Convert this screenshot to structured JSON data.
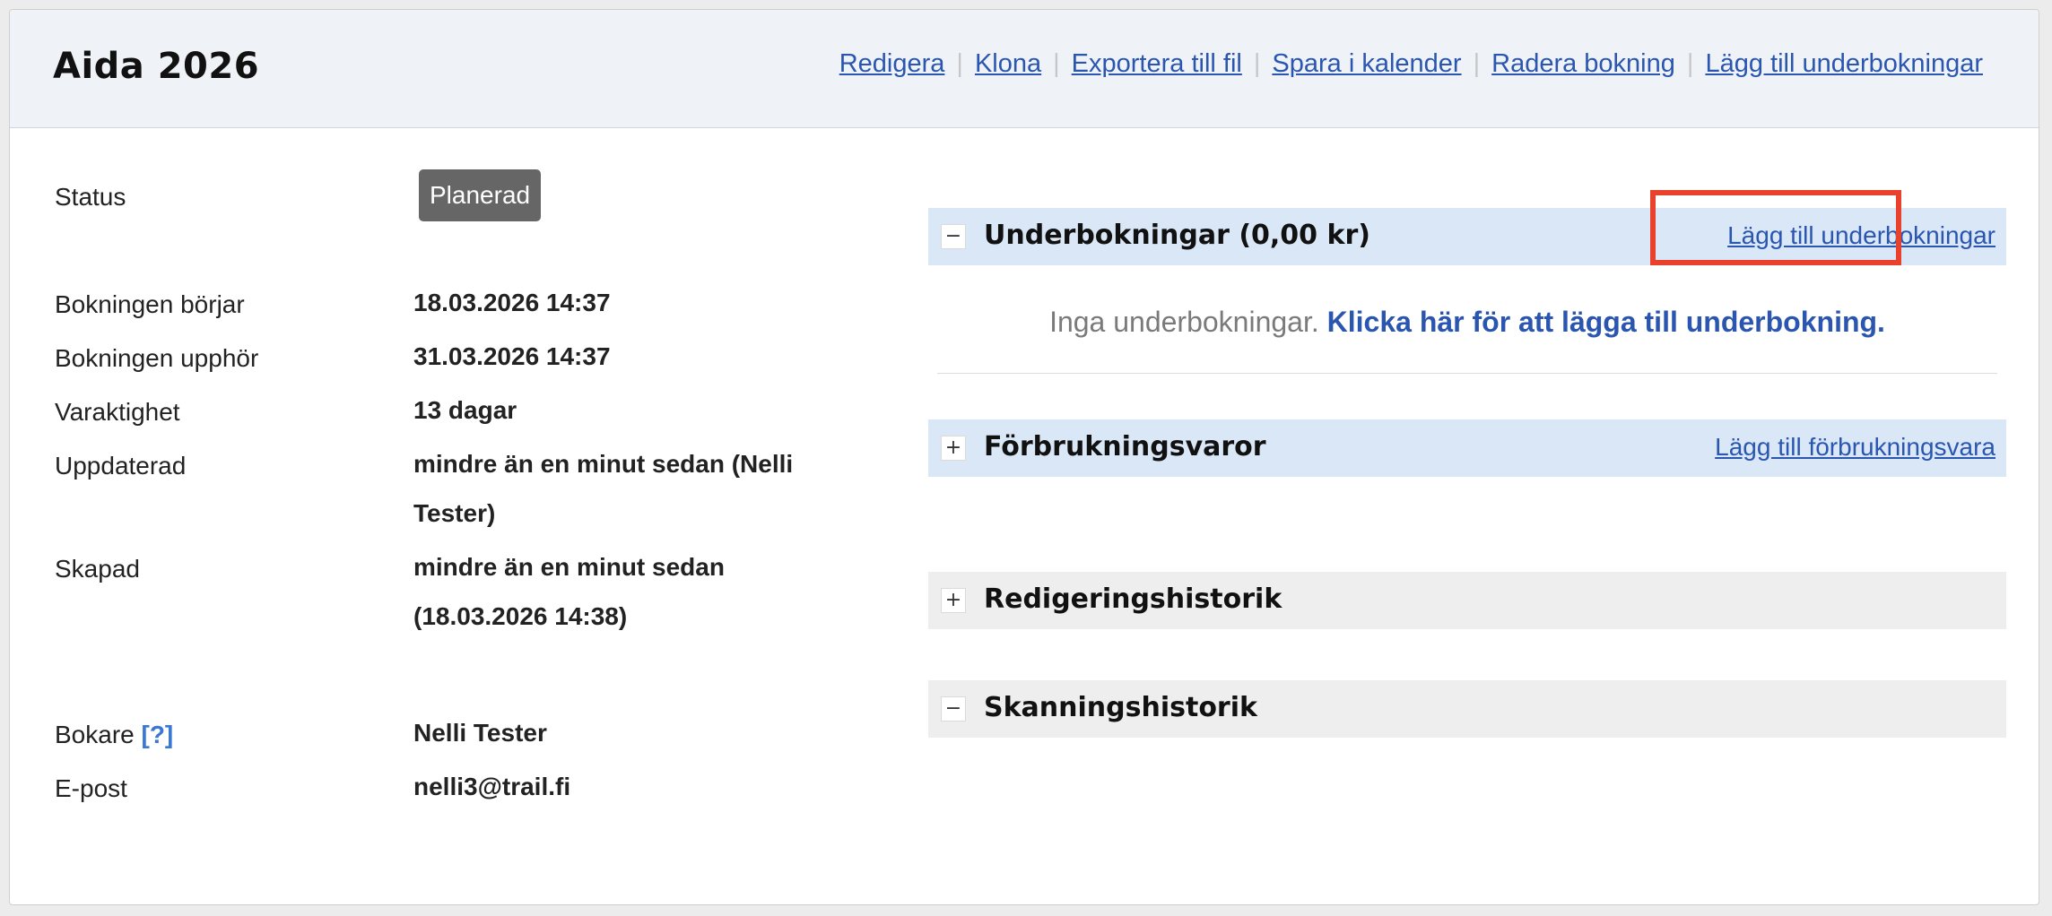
{
  "header": {
    "title": "Aida 2026",
    "actions": [
      {
        "label": "Redigera"
      },
      {
        "label": "Klona"
      },
      {
        "label": "Exportera till fil"
      },
      {
        "label": "Spara i kalender"
      },
      {
        "label": "Radera bokning"
      },
      {
        "label": "Lägg till underbokningar"
      }
    ],
    "separator": "|"
  },
  "details": {
    "status": {
      "label": "Status",
      "badge": "Planerad"
    },
    "start": {
      "label": "Bokningen börjar",
      "value": "18.03.2026 14:37"
    },
    "end": {
      "label": "Bokningen upphör",
      "value": "31.03.2026 14:37"
    },
    "duration": {
      "label": "Varaktighet",
      "value": "13 dagar"
    },
    "updated": {
      "label": "Uppdaterad",
      "value_line1": "mindre än en minut sedan (Nelli",
      "value_line2": "Tester)"
    },
    "created": {
      "label": "Skapad",
      "value_line1": "mindre än en minut sedan",
      "value_line2": "(18.03.2026 14:38)"
    },
    "booker": {
      "label": "Bokare",
      "help": "[?]",
      "value": "Nelli Tester"
    },
    "email": {
      "label": "E-post",
      "value": "nelli3@trail.fi"
    }
  },
  "sections": {
    "subbookings": {
      "toggle": "−",
      "title": "Underbokningar (0,00 kr)",
      "link": "Lägg till underbokningar",
      "empty_text": "Inga underbokningar.",
      "empty_link": "Klicka här för att lägga till underbokning."
    },
    "consumables": {
      "toggle": "+",
      "title": "Förbrukningsvaror",
      "link": "Lägg till förbrukningsvara"
    },
    "edit_history": {
      "toggle": "+",
      "title": "Redigeringshistorik"
    },
    "scan_history": {
      "toggle": "−",
      "title": "Skanningshistorik"
    }
  },
  "colors": {
    "link": "#2a56b0",
    "highlight": "#e8412c",
    "badge": "#666666",
    "section_blue": "#d9e7f7",
    "section_gray": "#eeeeee"
  }
}
